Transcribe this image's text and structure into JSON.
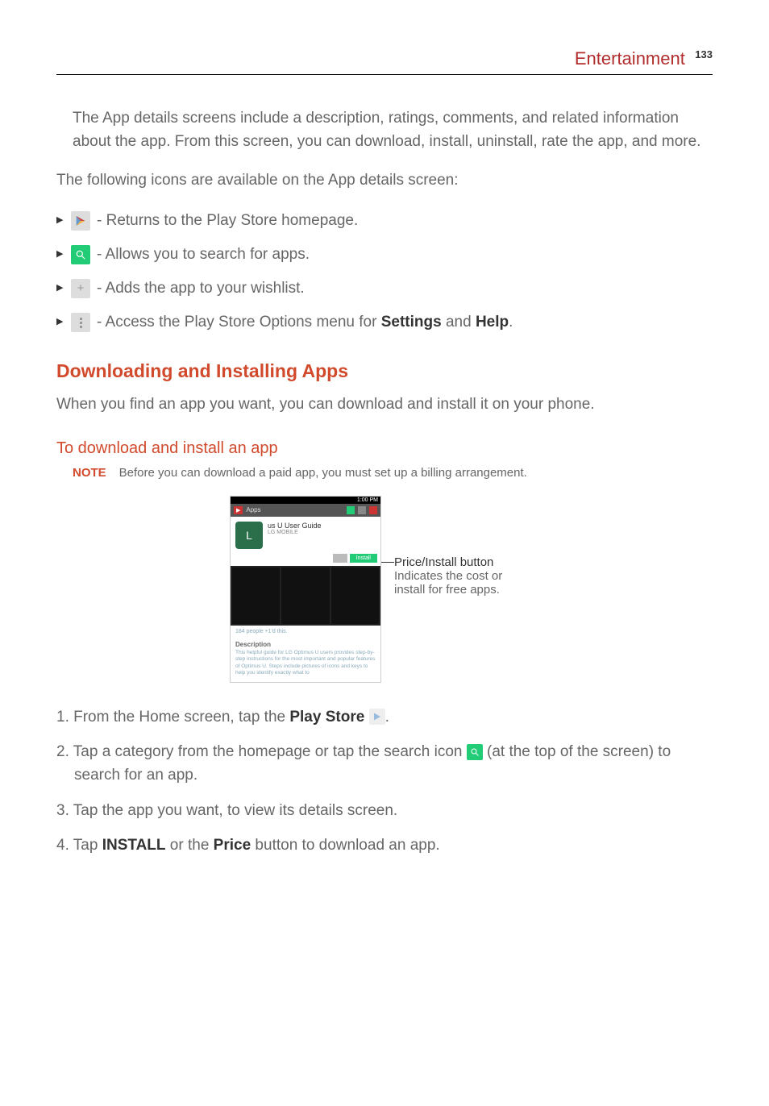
{
  "header": {
    "section": "Entertainment",
    "page_num": "133"
  },
  "intro_para": "The App details screens include a description, ratings, comments, and related information about the app. From this screen, you can download, install, uninstall, rate the app, and more.",
  "icons_intro": "The following icons are available on the App details screen:",
  "bullets": {
    "b1": " - Returns to the Play Store homepage.",
    "b2": " - Allows you to search for apps.",
    "b3": " - Adds the app to your wishlist.",
    "b4_pre": " - Access the Play Store Options menu for ",
    "b4_s": "Settings",
    "b4_and": " and ",
    "b4_h": "Help",
    "b4_end": "."
  },
  "h2": "Downloading and Installing Apps",
  "h2_para": "When you find an app you want, you can download and install it on your phone.",
  "h3": "To download and install an app",
  "note": {
    "label": "NOTE",
    "text": "Before you can download a paid app, you must set up a billing arrangement."
  },
  "screenshot": {
    "status_time": "1:00 PM",
    "bar_apps": "Apps",
    "app_title": "us U User Guide",
    "app_publisher": "LG MOBILE",
    "install_btn": "Install",
    "meta_line": "184 people +1'd this.",
    "desc_heading": "Description",
    "desc_text": "This helpful guide for LG Optimus U users provides step-by-step instructions for the most important and popular features of Optimus U. Steps include pictures of icons and keys to help you identify exactly what to"
  },
  "callout": {
    "title": "Price/Install button",
    "line1": "Indicates the cost or",
    "line2": "install for free apps."
  },
  "steps": {
    "s1_pre": "1. From the Home screen, tap the ",
    "s1_bold": "Play Store",
    "s1_post": " ",
    "s1_end": ".",
    "s2_pre": "2. Tap a category from the homepage or tap the search icon ",
    "s2_post": " (at the top of the screen) to search for an app.",
    "s3": "3. Tap the app you want, to view its details screen.",
    "s4_pre": "4. Tap ",
    "s4_install": "INSTALL",
    "s4_mid": " or the ",
    "s4_price": "Price",
    "s4_end": " button to download an app."
  }
}
